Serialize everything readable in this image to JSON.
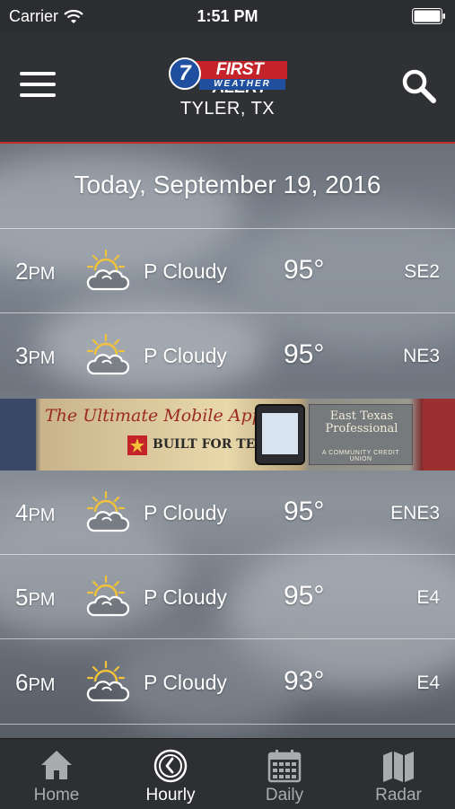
{
  "status_bar": {
    "carrier": "Carrier",
    "time": "1:51 PM"
  },
  "header": {
    "logo": {
      "number": "7",
      "main": "FIRST ALERT",
      "sub": "WEATHER"
    },
    "location": "TYLER, TX",
    "menu_icon": "hamburger-menu-icon",
    "search_icon": "search-icon"
  },
  "date_heading": "Today, September 19, 2016",
  "hourly": [
    {
      "hour": "2",
      "ampm": "PM",
      "icon": "partly-cloudy-icon",
      "condition": "P Cloudy",
      "temp": "95°",
      "wind": "SE2"
    },
    {
      "hour": "3",
      "ampm": "PM",
      "icon": "partly-cloudy-icon",
      "condition": "P Cloudy",
      "temp": "95°",
      "wind": "NE3"
    },
    {
      "hour": "4",
      "ampm": "PM",
      "icon": "partly-cloudy-icon",
      "condition": "P Cloudy",
      "temp": "95°",
      "wind": "ENE3"
    },
    {
      "hour": "5",
      "ampm": "PM",
      "icon": "partly-cloudy-icon",
      "condition": "P Cloudy",
      "temp": "95°",
      "wind": "E4"
    },
    {
      "hour": "6",
      "ampm": "PM",
      "icon": "partly-cloudy-icon",
      "condition": "P Cloudy",
      "temp": "93°",
      "wind": "E4"
    }
  ],
  "ad": {
    "title": "The Ultimate Mobile App",
    "tagline": "BUILT FOR TEXANS",
    "sponsor_name": "East Texas Professional",
    "sponsor_sub": "A COMMUNITY CREDIT UNION"
  },
  "tabs": [
    {
      "label": "Home",
      "icon": "home-icon",
      "active": false
    },
    {
      "label": "Hourly",
      "icon": "clock-icon",
      "active": true
    },
    {
      "label": "Daily",
      "icon": "calendar-icon",
      "active": false
    },
    {
      "label": "Radar",
      "icon": "map-icon",
      "active": false
    }
  ],
  "colors": {
    "accent_red": "#c2302b",
    "header_bg": "#2f3134",
    "sun_yellow": "#f2c23a"
  }
}
